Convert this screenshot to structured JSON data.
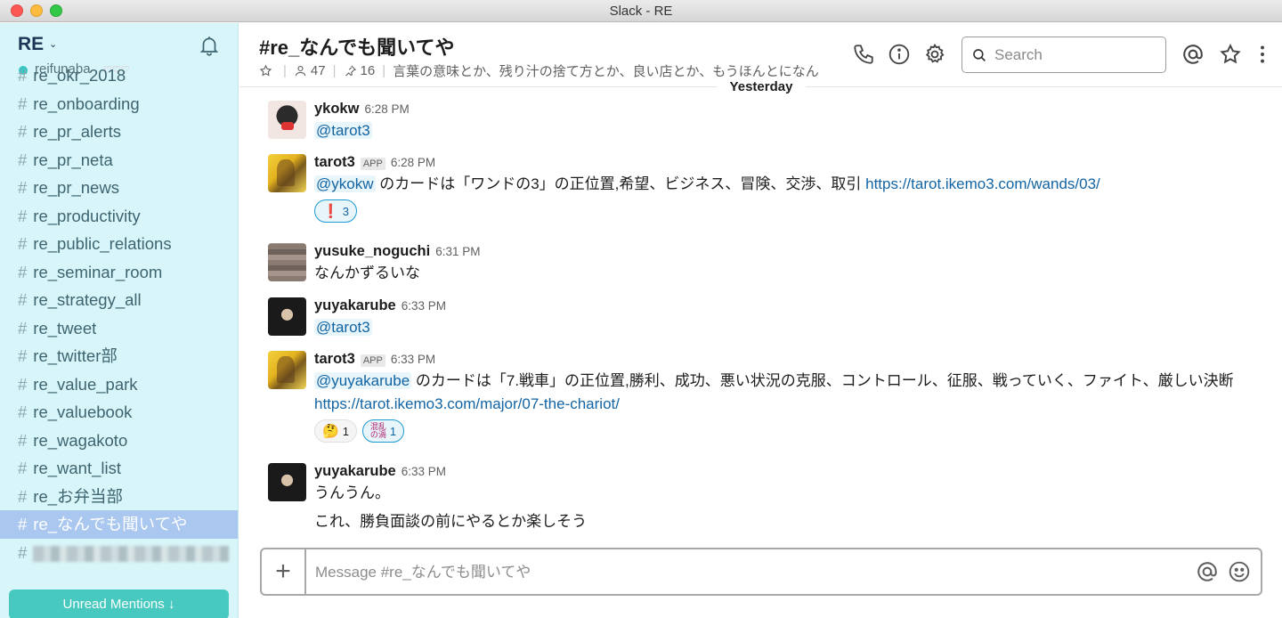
{
  "window": {
    "title": "Slack - RE"
  },
  "sidebar": {
    "workspace": "RE",
    "caret": "⌄",
    "user": "reifunaba",
    "user_emoji": "♡♡♡",
    "channels": [
      {
        "label": "re_okr_2018"
      },
      {
        "label": "re_onboarding"
      },
      {
        "label": "re_pr_alerts"
      },
      {
        "label": "re_pr_neta"
      },
      {
        "label": "re_pr_news"
      },
      {
        "label": "re_productivity"
      },
      {
        "label": "re_public_relations"
      },
      {
        "label": "re_seminar_room"
      },
      {
        "label": "re_strategy_all"
      },
      {
        "label": "re_tweet"
      },
      {
        "label": "re_twitter部"
      },
      {
        "label": "re_value_park"
      },
      {
        "label": "re_valuebook"
      },
      {
        "label": "re_wagakoto"
      },
      {
        "label": "re_want_list"
      },
      {
        "label": "re_お弁当部"
      },
      {
        "label": "re_なんでも聞いてや"
      }
    ],
    "unread_button": "Unread Mentions ↓"
  },
  "header": {
    "channel_title": "#re_なんでも聞いてや",
    "members": "47",
    "pins": "16",
    "topic": "言葉の意味とか、残り汁の捨て方とか、良い店とか、もうほんとになん",
    "search_placeholder": "Search"
  },
  "day_divider": "Yesterday",
  "messages": [
    {
      "author": "ykokw",
      "time": "6:28 PM",
      "mention": "@tarot3"
    },
    {
      "author": "tarot3",
      "badge": "APP",
      "time": "6:28 PM",
      "mention": "@ykokw",
      "text": " のカードは「ワンドの3」の正位置,希望、ビジネス、冒険、交渉、取引 ",
      "link": "https://tarot.ikemo3.com/wands/03/",
      "reactions": [
        {
          "emoji": "❗",
          "count": "3"
        }
      ]
    },
    {
      "author": "yusuke_noguchi",
      "time": "6:31 PM",
      "text": "なんかずるいな"
    },
    {
      "author": "yuyakarube",
      "time": "6:33 PM",
      "mention": "@tarot3"
    },
    {
      "author": "tarot3",
      "badge": "APP",
      "time": "6:33 PM",
      "mention": "@yuyakarube",
      "text": " のカードは「7.戦車」の正位置,勝利、成功、悪い状況の克服、コントロール、征服、戦っていく、ファイト、厳しい決断 ",
      "link": "https://tarot.ikemo3.com/major/07-the-chariot/",
      "reactions": [
        {
          "emoji": "🤔",
          "count": "1"
        },
        {
          "emoji": "混乱の渦",
          "count": "1"
        }
      ]
    },
    {
      "author": "yuyakarube",
      "time": "6:33 PM",
      "text": "うんうん。",
      "text2": "これ、勝負面談の前にやるとか楽しそう"
    }
  ],
  "composer": {
    "placeholder": "Message #re_なんでも聞いてや",
    "plus": "+"
  },
  "colors": {
    "sidebar_bg": "#d8f6f9",
    "active_channel": "#a9c7ef",
    "link": "#1264a3"
  }
}
